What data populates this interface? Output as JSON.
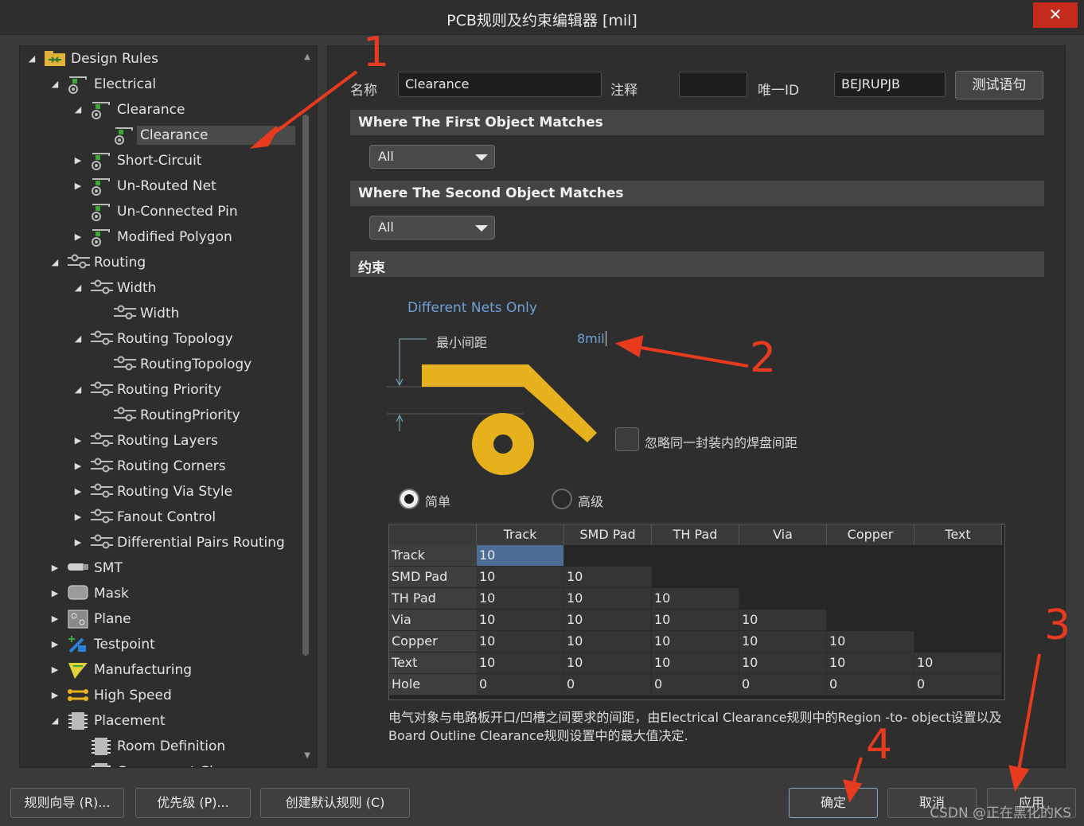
{
  "window": {
    "title": "PCB规则及约束编辑器 [mil]",
    "close_glyph": "✕"
  },
  "tree": {
    "items": [
      {
        "label": "Design Rules",
        "level": 0,
        "exp": "open",
        "icon": "folder-rules-icon"
      },
      {
        "label": "Electrical",
        "level": 1,
        "exp": "open",
        "icon": "electrical-rule-icon"
      },
      {
        "label": "Clearance",
        "level": 2,
        "exp": "open",
        "icon": "electrical-rule-icon"
      },
      {
        "label": "Clearance",
        "level": 3,
        "exp": "none",
        "icon": "electrical-rule-icon",
        "selected": true
      },
      {
        "label": "Short-Circuit",
        "level": 2,
        "exp": "closed",
        "icon": "electrical-rule-icon"
      },
      {
        "label": "Un-Routed Net",
        "level": 2,
        "exp": "closed",
        "icon": "electrical-rule-icon"
      },
      {
        "label": "Un-Connected Pin",
        "level": 2,
        "exp": "none",
        "icon": "electrical-rule-icon"
      },
      {
        "label": "Modified Polygon",
        "level": 2,
        "exp": "closed",
        "icon": "electrical-rule-icon"
      },
      {
        "label": "Routing",
        "level": 1,
        "exp": "open",
        "icon": "routing-rule-icon"
      },
      {
        "label": "Width",
        "level": 2,
        "exp": "open",
        "icon": "routing-rule-icon"
      },
      {
        "label": "Width",
        "level": 3,
        "exp": "none",
        "icon": "routing-rule-icon"
      },
      {
        "label": "Routing Topology",
        "level": 2,
        "exp": "open",
        "icon": "routing-rule-icon"
      },
      {
        "label": "RoutingTopology",
        "level": 3,
        "exp": "none",
        "icon": "routing-rule-icon"
      },
      {
        "label": "Routing Priority",
        "level": 2,
        "exp": "open",
        "icon": "routing-rule-icon"
      },
      {
        "label": "RoutingPriority",
        "level": 3,
        "exp": "none",
        "icon": "routing-rule-icon"
      },
      {
        "label": "Routing Layers",
        "level": 2,
        "exp": "closed",
        "icon": "routing-rule-icon"
      },
      {
        "label": "Routing Corners",
        "level": 2,
        "exp": "closed",
        "icon": "routing-rule-icon"
      },
      {
        "label": "Routing Via Style",
        "level": 2,
        "exp": "closed",
        "icon": "routing-rule-icon"
      },
      {
        "label": "Fanout Control",
        "level": 2,
        "exp": "closed",
        "icon": "routing-rule-icon"
      },
      {
        "label": "Differential Pairs Routing",
        "level": 2,
        "exp": "closed",
        "icon": "routing-rule-icon"
      },
      {
        "label": "SMT",
        "level": 1,
        "exp": "closed",
        "icon": "smt-icon"
      },
      {
        "label": "Mask",
        "level": 1,
        "exp": "closed",
        "icon": "mask-icon"
      },
      {
        "label": "Plane",
        "level": 1,
        "exp": "closed",
        "icon": "plane-icon"
      },
      {
        "label": "Testpoint",
        "level": 1,
        "exp": "closed",
        "icon": "testpoint-icon"
      },
      {
        "label": "Manufacturing",
        "level": 1,
        "exp": "closed",
        "icon": "manufacturing-icon"
      },
      {
        "label": "High Speed",
        "level": 1,
        "exp": "closed",
        "icon": "high-speed-icon"
      },
      {
        "label": "Placement",
        "level": 1,
        "exp": "open",
        "icon": "placement-icon"
      },
      {
        "label": "Room Definition",
        "level": 2,
        "exp": "none",
        "icon": "placement-icon"
      },
      {
        "label": "Component Cl...",
        "level": 2,
        "exp": "none",
        "icon": "placement-icon"
      }
    ]
  },
  "rule": {
    "name_label": "名称",
    "name_value": "Clearance",
    "comment_label": "注释",
    "comment_value": "",
    "uid_label": "唯一ID",
    "uid_value": "BEJRUPJB",
    "test_button": "测试语句"
  },
  "first_match": {
    "header": "Where The First Object Matches",
    "value": "All"
  },
  "second_match": {
    "header": "Where The Second Object Matches",
    "value": "All"
  },
  "constraints": {
    "header": "约束",
    "net_scope": "Different Nets Only",
    "min_clearance_label": "最小间距",
    "min_clearance_value": "8mil",
    "ignore_pad_label": "忽略同一封装内的焊盘间距",
    "mode_simple": "简单",
    "mode_advanced": "高级"
  },
  "matrix": {
    "columns": [
      "Track",
      "SMD Pad",
      "TH Pad",
      "Via",
      "Copper",
      "Text"
    ],
    "rows": [
      {
        "name": "Track",
        "values": [
          "10"
        ]
      },
      {
        "name": "SMD Pad",
        "values": [
          "10",
          "10"
        ]
      },
      {
        "name": "TH Pad",
        "values": [
          "10",
          "10",
          "10"
        ]
      },
      {
        "name": "Via",
        "values": [
          "10",
          "10",
          "10",
          "10"
        ]
      },
      {
        "name": "Copper",
        "values": [
          "10",
          "10",
          "10",
          "10",
          "10"
        ]
      },
      {
        "name": "Text",
        "values": [
          "10",
          "10",
          "10",
          "10",
          "10",
          "10"
        ]
      },
      {
        "name": "Hole",
        "values": [
          "0",
          "0",
          "0",
          "0",
          "0",
          "0"
        ]
      }
    ]
  },
  "description": "电气对象与电路板开口/凹槽之间要求的间距，由Electrical Clearance规则中的Region -to- object设置以及Board Outline Clearance规则设置中的最大值决定.",
  "footer": {
    "wizard": "规则向导 (R)...",
    "priority": "优先级 (P)...",
    "create_default": "创建默认规则 (C)",
    "ok": "确定",
    "cancel": "取消",
    "apply": "应用"
  },
  "watermark": "CSDN @正在黑化的KS",
  "annotations": [
    "1",
    "2",
    "3",
    "4"
  ],
  "colors": {
    "accent_copper": "#e6b11c",
    "annotation_red": "#e83a1e",
    "selection_blue": "#4c6d96"
  }
}
